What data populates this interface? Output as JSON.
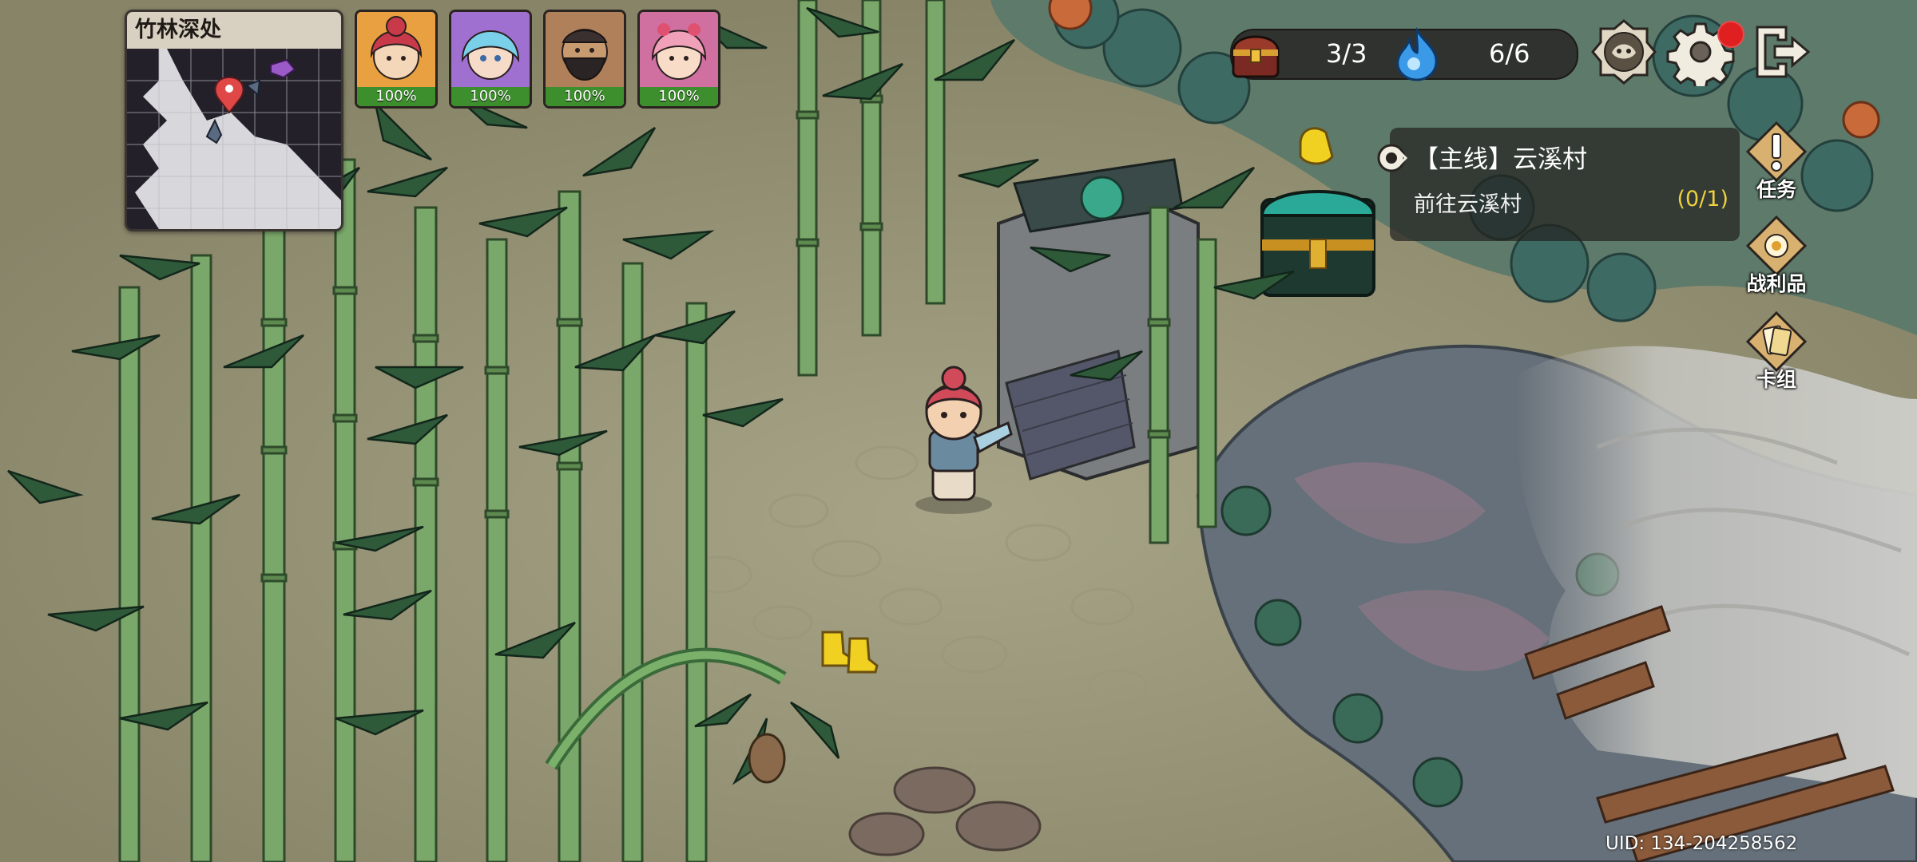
{
  "map": {
    "area_name": "竹林深处"
  },
  "party": [
    {
      "name": "red-haired-girl",
      "hp": "100%",
      "bg": "#e8a040"
    },
    {
      "name": "blue-haired-girl",
      "hp": "100%",
      "bg": "#a070d0"
    },
    {
      "name": "bearded-warrior",
      "hp": "100%",
      "bg": "#b0805a"
    },
    {
      "name": "pink-haired-girl",
      "hp": "100%",
      "bg": "#d070a0"
    }
  ],
  "resources": {
    "chest_count": "3/3",
    "stamina_count": "6/6"
  },
  "quest": {
    "title": "【主线】云溪村",
    "description": "前往云溪村",
    "progress": "(0/1)"
  },
  "side_menu": {
    "tasks_label": "任务",
    "loot_label": "战利品",
    "deck_label": "卡组"
  },
  "icons": {
    "treasure": "treasure-chest-icon",
    "stamina": "blue-flame-icon",
    "codex": "mask-badge-icon",
    "settings": "gear-icon",
    "exit": "exit-door-icon"
  },
  "footer": {
    "uid": "UID: 134-204258562"
  },
  "colors": {
    "hp_bar": "#3c8f2c",
    "notification_dot": "#e02020",
    "quest_progress": "#f0d040"
  }
}
